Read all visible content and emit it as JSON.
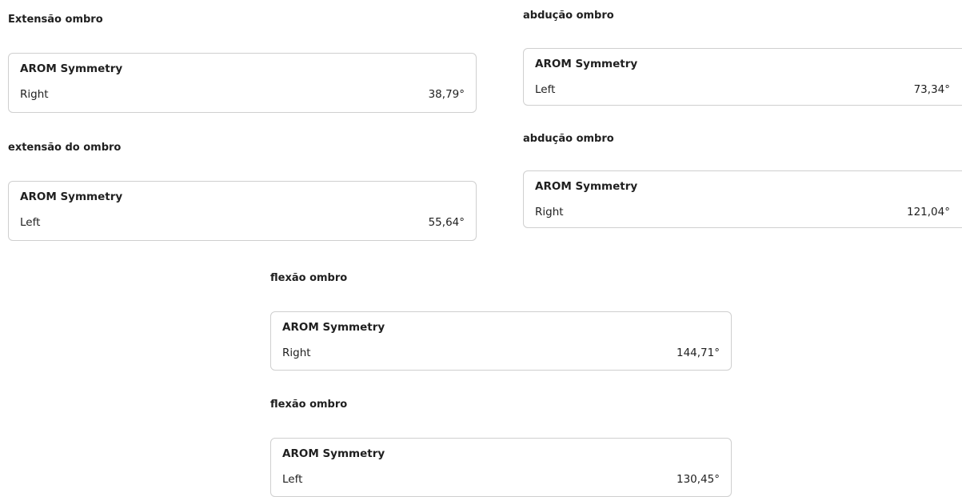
{
  "sections": [
    {
      "title": "Extensão ombro",
      "card": {
        "title": "AROM Symmetry",
        "side": "Right",
        "value": "38,79°"
      }
    },
    {
      "title": "extensão do ombro",
      "card": {
        "title": "AROM Symmetry",
        "side": "Left",
        "value": "55,64°"
      }
    },
    {
      "title": "abdução ombro",
      "card": {
        "title": "AROM Symmetry",
        "side": "Left",
        "value": "73,34°"
      }
    },
    {
      "title": "abdução ombro",
      "card": {
        "title": "AROM Symmetry",
        "side": "Right",
        "value": "121,04°"
      }
    },
    {
      "title": "flexão ombro",
      "card": {
        "title": "AROM Symmetry",
        "side": "Right",
        "value": "144,71°"
      }
    },
    {
      "title": "flexão ombro",
      "card": {
        "title": "AROM Symmetry",
        "side": "Left",
        "value": "130,45°"
      }
    }
  ]
}
